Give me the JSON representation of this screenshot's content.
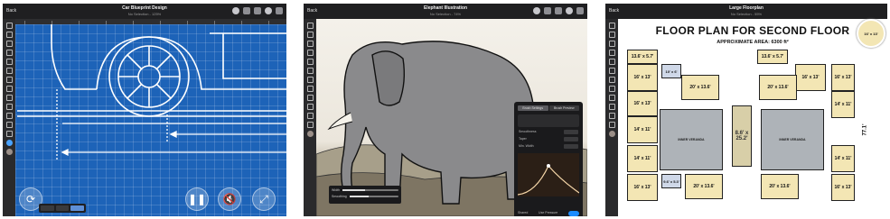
{
  "screens": [
    {
      "topbar": {
        "back": "Back",
        "title": "Car Blueprint Design",
        "subtitle": "No Selection - 125%"
      }
    },
    {
      "topbar": {
        "back": "Back",
        "title": "Elephant Illustration",
        "subtitle": "No Selection - 74%"
      },
      "panel": {
        "tabs": [
          "Brush Settings",
          "Brush Preview"
        ],
        "rows": [
          "Smoothness",
          "Taper",
          "Min. Width"
        ],
        "footer_left": "Shared",
        "footer_right": "Use Pressure"
      },
      "sliders": {
        "width": "Width",
        "smoothing": "Smoothing"
      }
    },
    {
      "topbar": {
        "back": "Back",
        "title": "Large Floorplan",
        "subtitle": "No Selection - 55%"
      },
      "plan": {
        "title": "FLOOR PLAN FOR SECOND FLOOR",
        "area": "APPROXIMATE AREA: 6300 ft²",
        "zoom_label": "16' x 13'",
        "dim_vertical": "77.1'",
        "rooms": [
          "13.6' x 5.7'",
          "16' x 13'",
          "10' x 6'",
          "20' x 13.6'",
          "16' x 13'",
          "14' x 11'",
          "8.6' x 25.2'",
          "INNER VERANDA",
          "16' x 13'",
          "20' x 13.6'",
          "16' x 13'",
          "14' x 11'",
          "13.6' x 5.7'",
          "14' x 11'",
          "16' x 13'",
          "9.6' x 5.3'",
          "INNER VERANDA",
          "20' x 13.6'",
          "16' x 13'"
        ]
      }
    }
  ],
  "colors": {
    "blueprint": "#1d63b8",
    "accent": "#1c8cff",
    "room_fill": "#f3e6b4"
  }
}
